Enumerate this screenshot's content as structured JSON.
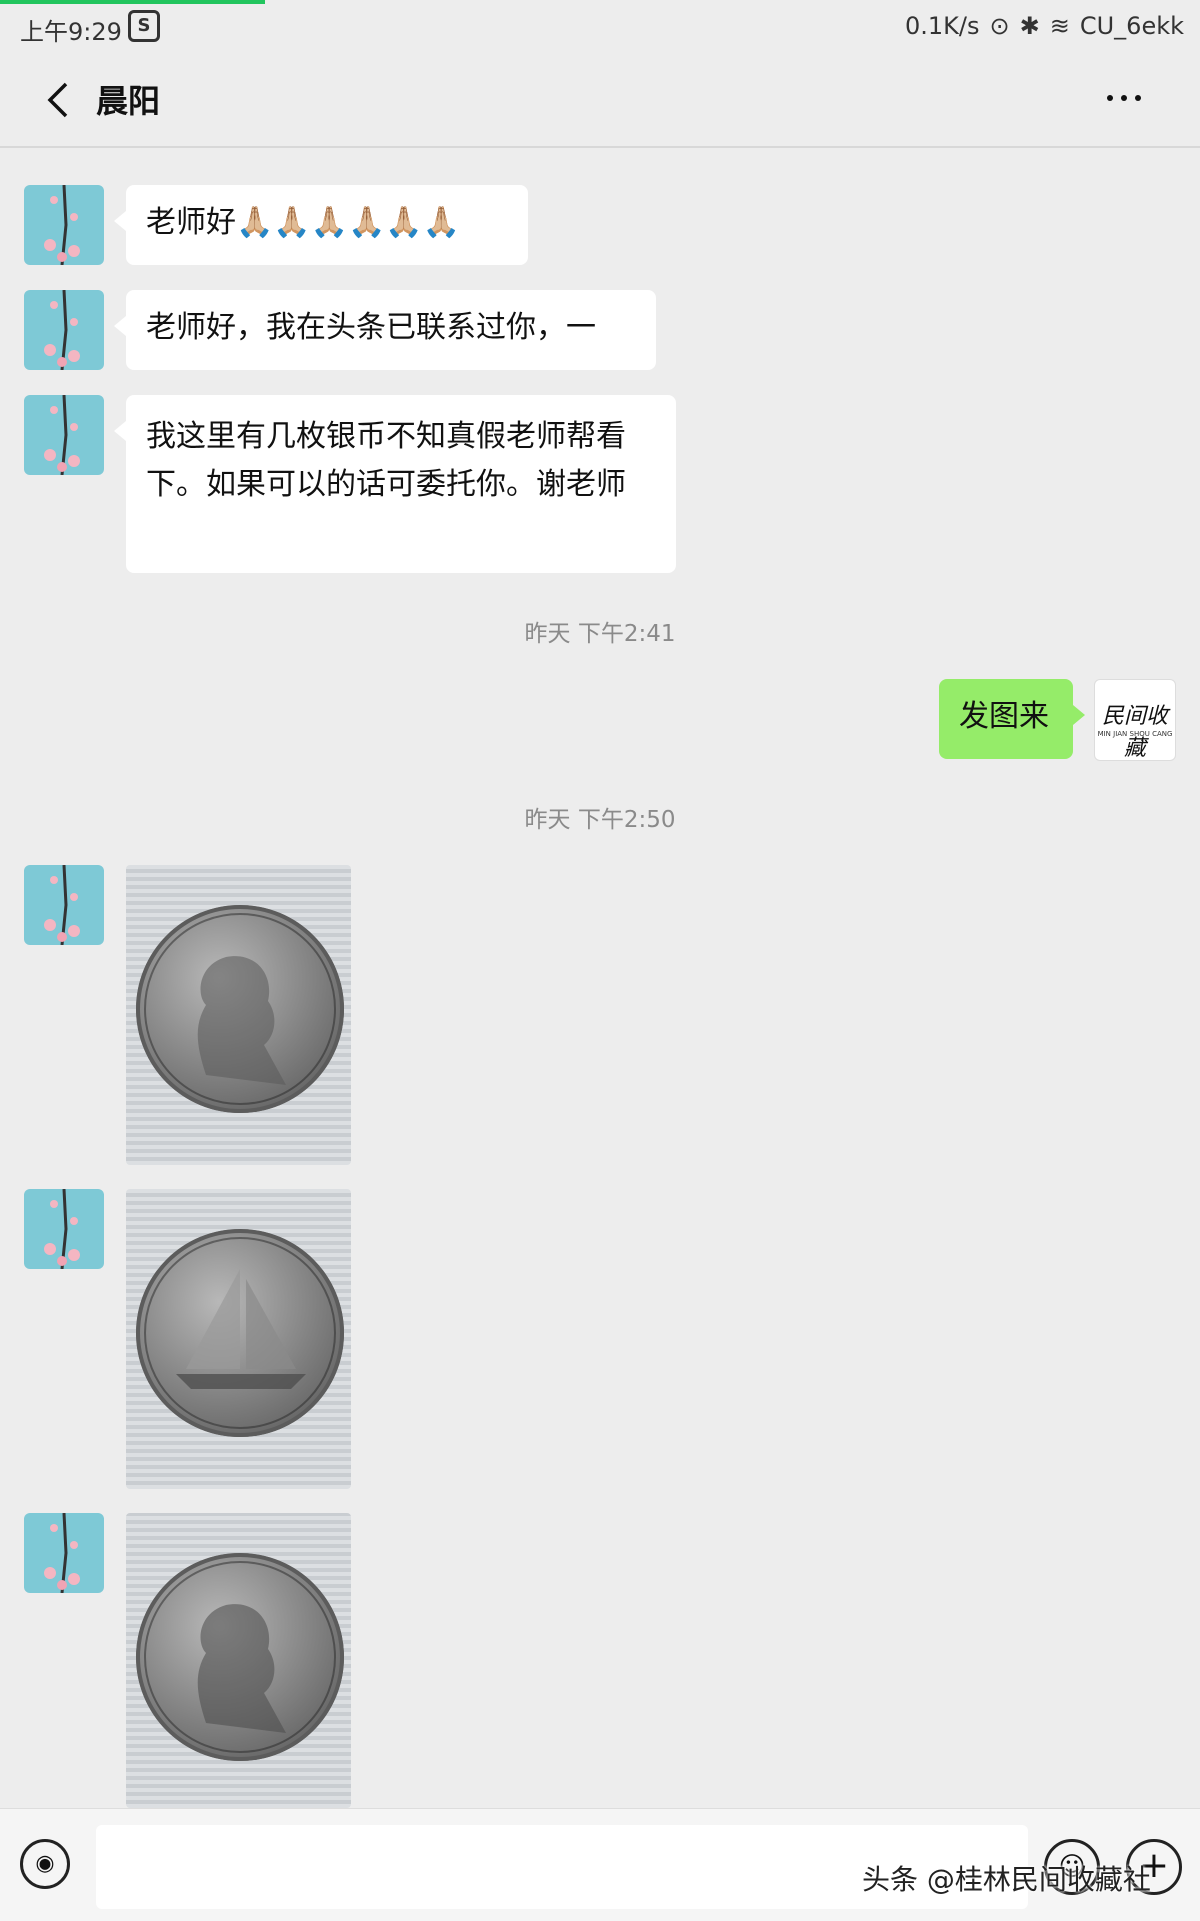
{
  "status_bar": {
    "time": "上午9:29",
    "app_icon": "S",
    "speed": "0.1K/s",
    "wifi_name": "CU_6ekk"
  },
  "header": {
    "title": "晨阳"
  },
  "messages": [
    {
      "from": "peer",
      "text": "老师好🙏🏼🙏🏼🙏🏼🙏🏼🙏🏼🙏🏼"
    },
    {
      "from": "peer",
      "text": "老师好，我在头条已联系过你，一"
    },
    {
      "from": "peer",
      "text": "我这里有几枚银币不知真假老师帮看下。如果可以的话可委托你。谢老师"
    },
    {
      "from": "self",
      "text": "发图来"
    }
  ],
  "timestamps": [
    "昨天 下午2:41",
    "昨天 下午2:50"
  ],
  "self_avatar": {
    "logo_text": "民间收藏",
    "logo_sub": "MIN JIAN SHOU CANG"
  },
  "watermark": "头条 @桂林民间收藏社",
  "colors": {
    "background": "#ededed",
    "self_bubble": "#95ec69",
    "peer_bubble": "#ffffff",
    "peer_avatar": "#7ec9d6"
  },
  "icons": [
    "back-icon",
    "more-icon",
    "voice-icon",
    "emoji-icon",
    "plus-icon",
    "bluetooth-icon",
    "wifi-icon"
  ]
}
